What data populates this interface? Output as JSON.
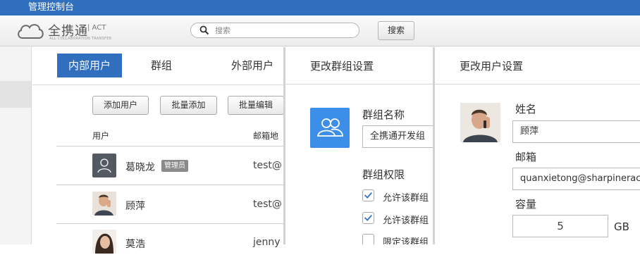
{
  "titlebar": {
    "title": "管理控制台"
  },
  "logo": {
    "name": "全携通",
    "act": "| ACT",
    "tagline": "ALL COLLABORATION TRANSFER"
  },
  "search": {
    "placeholder": "搜索",
    "button_label": "搜索"
  },
  "users_panel": {
    "tabs": [
      {
        "label": "内部用户",
        "active": true
      },
      {
        "label": "群组",
        "active": false
      },
      {
        "label": "外部用户",
        "active": false
      }
    ],
    "actions": {
      "add_user": "添加用户",
      "batch_add": "批量添加",
      "batch_edit": "批量编辑"
    },
    "columns": {
      "user": "用户",
      "email": "邮箱地"
    },
    "rows": [
      {
        "name": "葛晓龙",
        "badge": "管理员",
        "email": "test@",
        "avatar": "default-user-icon"
      },
      {
        "name": "顾萍",
        "badge": "",
        "email": "test@",
        "avatar": "photo"
      },
      {
        "name": "莫浩",
        "badge": "",
        "email": "jenny",
        "avatar": "photo"
      }
    ]
  },
  "group_panel": {
    "title": "更改群组设置",
    "name_label": "群组名称",
    "name_value": "全携通开发组",
    "permissions_label": "群组权限",
    "permissions": [
      {
        "label": "允许该群组",
        "checked": true
      },
      {
        "label": "允许该群组",
        "checked": true
      },
      {
        "label": "限定该群组",
        "checked": false
      }
    ]
  },
  "user_panel": {
    "title": "更改用户设置",
    "name_label": "姓名",
    "name_value": "顾萍",
    "email_label": "邮箱",
    "email_value": "quanxietong@sharpineract",
    "quota_label": "容量",
    "quota_value": "5",
    "quota_unit": "GB"
  },
  "colors": {
    "brand": "#2f6fbe",
    "group_icon_bg": "#3d8ee8",
    "badge_bg": "#8a8a8a"
  }
}
